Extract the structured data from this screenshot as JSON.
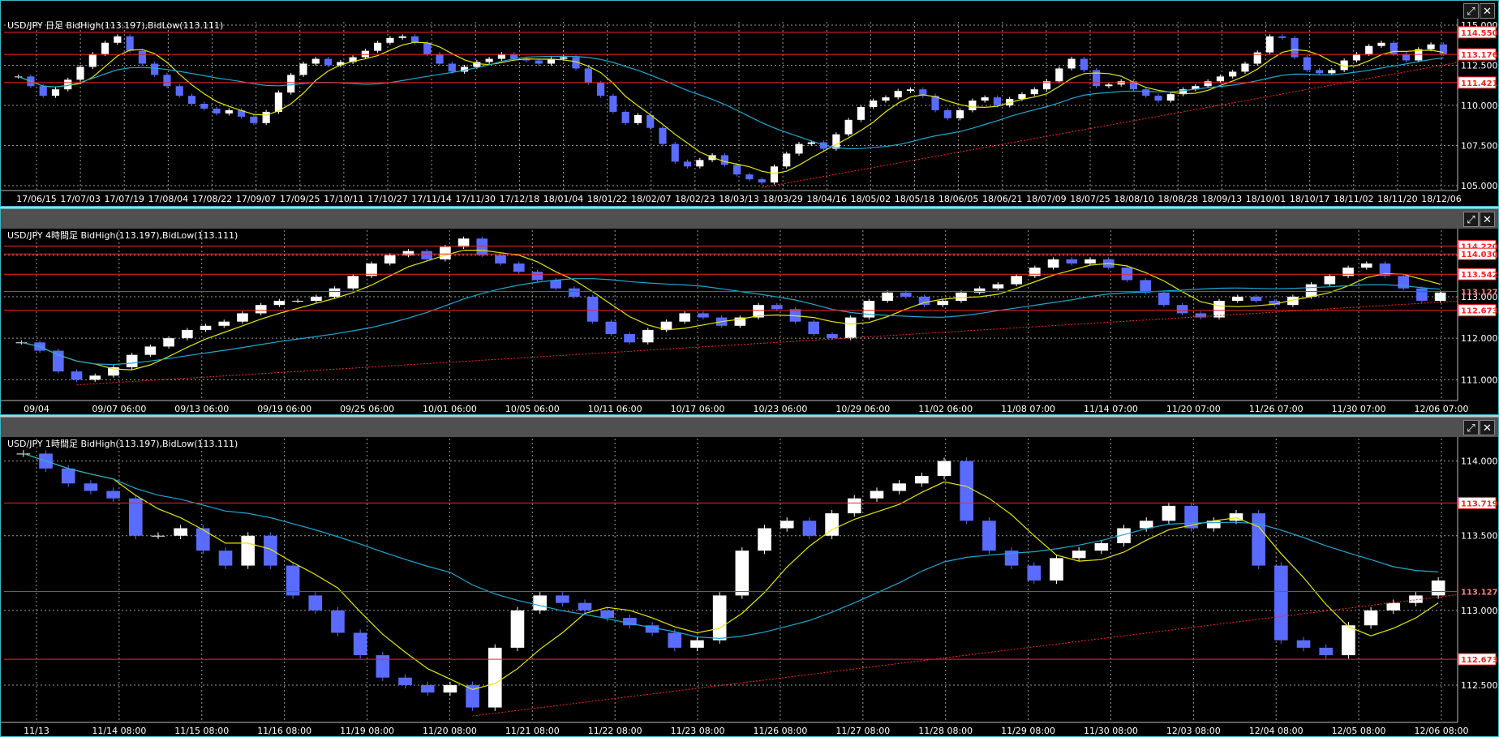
{
  "colors": {
    "frame": "#3fb8c8",
    "level_line": "#ff2020",
    "ma_fast": "#e6e600",
    "ma_slow": "#1ea8d0",
    "bull": "#ffffff",
    "bear": "#5a6cff",
    "grid": "#9a9a9a"
  },
  "window_buttons": {
    "maximize": "⤢",
    "close": "✕"
  },
  "panels": [
    {
      "title": "USD/JPY 日足  BidHigh(113.197),BidLow(113.111)",
      "y_ticks": [
        "115.000",
        "112.500",
        "110.000",
        "107.500",
        "105.000"
      ],
      "x_ticks": [
        "17/06/15",
        "17/07/03",
        "17/07/19",
        "17/08/04",
        "17/08/22",
        "17/09/07",
        "17/09/25",
        "17/10/11",
        "17/10/27",
        "17/11/14",
        "17/11/30",
        "17/12/18",
        "18/01/04",
        "18/01/22",
        "18/02/07",
        "18/02/23",
        "18/03/13",
        "18/03/29",
        "18/04/16",
        "18/05/02",
        "18/05/18",
        "18/06/05",
        "18/06/21",
        "18/07/09",
        "18/07/25",
        "18/08/10",
        "18/08/28",
        "18/09/13",
        "18/10/01",
        "18/10/17",
        "18/11/02",
        "18/11/20",
        "18/12/06"
      ],
      "level_tags": [
        {
          "text": "114.550",
          "style": "boxed"
        },
        {
          "text": "113.176",
          "style": "boxed"
        },
        {
          "text": "111.421",
          "style": "boxed"
        }
      ]
    },
    {
      "title": "USD/JPY 4時間足  BidHigh(113.197),BidLow(113.111)",
      "y_ticks": [
        "114.000",
        "113.000",
        "112.000",
        "111.000"
      ],
      "x_ticks": [
        "09/04",
        "09/07 06:00",
        "09/13 06:00",
        "09/19 06:00",
        "09/25 06:00",
        "10/01 06:00",
        "10/05 06:00",
        "10/11 06:00",
        "10/17 06:00",
        "10/23 06:00",
        "10/29 06:00",
        "11/02 06:00",
        "11/08 07:00",
        "11/14 07:00",
        "11/20 07:00",
        "11/26 07:00",
        "11/30 07:00",
        "12/06 07:00"
      ],
      "level_tags": [
        {
          "text": "114.220",
          "style": "boxed"
        },
        {
          "text": "114.030",
          "style": "boxed"
        },
        {
          "text": "113.542",
          "style": "boxed"
        },
        {
          "text": "113.127",
          "style": "plain"
        },
        {
          "text": "112.673",
          "style": "boxed"
        }
      ]
    },
    {
      "title": "USD/JPY 1時間足  BidHigh(113.197),BidLow(113.111)",
      "y_ticks": [
        "114.000",
        "113.500",
        "113.000",
        "112.500"
      ],
      "x_ticks": [
        "11/13",
        "11/14 08:00",
        "11/15 08:00",
        "11/16 08:00",
        "11/19 08:00",
        "11/20 08:00",
        "11/21 08:00",
        "11/22 08:00",
        "11/23 08:00",
        "11/26 08:00",
        "11/27 08:00",
        "11/28 08:00",
        "11/29 08:00",
        "11/30 08:00",
        "12/03 08:00",
        "12/04 08:00",
        "12/05 08:00",
        "12/06 08:00"
      ],
      "level_tags": [
        {
          "text": "113.719",
          "style": "boxed"
        },
        {
          "text": "113.127",
          "style": "plain"
        },
        {
          "text": "112.673",
          "style": "boxed"
        }
      ]
    }
  ],
  "chart_data": [
    {
      "type": "candlestick",
      "instrument": "USD/JPY",
      "timeframe": "日足",
      "ylim": [
        104.7,
        115.2
      ],
      "levels": [
        114.55,
        113.176,
        111.421
      ],
      "series": [
        {
          "name": "USD/JPY",
          "values": [
            111.8,
            111.2,
            110.6,
            111.0,
            111.6,
            112.4,
            113.2,
            113.9,
            114.3,
            113.4,
            112.6,
            111.9,
            111.2,
            110.6,
            110.1,
            109.8,
            109.5,
            109.7,
            109.3,
            108.9,
            109.6,
            110.8,
            111.9,
            112.6,
            112.9,
            112.5,
            112.7,
            113.0,
            113.4,
            113.9,
            114.2,
            114.3,
            113.9,
            113.2,
            112.6,
            112.1,
            112.4,
            112.7,
            112.9,
            113.2,
            112.9,
            112.8,
            112.6,
            112.9,
            113.0,
            112.3,
            111.4,
            110.6,
            109.6,
            108.9,
            109.4,
            108.6,
            107.6,
            106.5,
            106.2,
            106.6,
            106.9,
            106.3,
            105.7,
            105.4,
            105.2,
            106.2,
            107.0,
            107.6,
            107.7,
            107.3,
            108.2,
            109.1,
            109.9,
            110.3,
            110.5,
            110.9,
            111.0,
            110.6,
            109.7,
            109.2,
            109.7,
            110.3,
            110.5,
            110.0,
            110.4,
            110.7,
            111.0,
            111.5,
            112.3,
            112.9,
            112.2,
            111.2,
            111.3,
            111.5,
            111.0,
            110.6,
            110.3,
            110.7,
            111.0,
            111.2,
            111.5,
            111.8,
            112.1,
            112.6,
            113.3,
            114.3,
            114.2,
            113.0,
            112.2,
            112.0,
            112.2,
            112.8,
            113.2,
            113.7,
            113.9,
            113.2,
            112.8,
            113.5,
            113.8,
            113.2
          ]
        }
      ]
    },
    {
      "type": "candlestick",
      "instrument": "USD/JPY",
      "timeframe": "4時間足",
      "ylim": [
        110.5,
        114.6
      ],
      "levels": [
        114.22,
        114.03,
        113.542,
        113.127,
        112.673
      ],
      "series": [
        {
          "name": "USD/JPY",
          "values": [
            111.9,
            111.7,
            111.2,
            111.0,
            111.1,
            111.3,
            111.6,
            111.8,
            112.0,
            112.2,
            112.3,
            112.4,
            112.6,
            112.8,
            112.9,
            112.9,
            113.0,
            113.2,
            113.5,
            113.8,
            114.0,
            114.1,
            113.9,
            114.2,
            114.4,
            114.0,
            113.8,
            113.6,
            113.4,
            113.2,
            113.0,
            112.4,
            112.1,
            111.9,
            112.2,
            112.4,
            112.6,
            112.5,
            112.3,
            112.5,
            112.8,
            112.7,
            112.4,
            112.1,
            112.0,
            112.5,
            112.9,
            113.1,
            113.0,
            112.8,
            112.9,
            113.1,
            113.2,
            113.3,
            113.5,
            113.7,
            113.9,
            113.8,
            113.9,
            113.7,
            113.4,
            113.1,
            112.8,
            112.6,
            112.5,
            112.9,
            113.0,
            112.9,
            112.8,
            113.0,
            113.3,
            113.5,
            113.7,
            113.8,
            113.5,
            113.2,
            112.9,
            113.1
          ]
        }
      ]
    },
    {
      "type": "candlestick",
      "instrument": "USD/JPY",
      "timeframe": "1時間足",
      "ylim": [
        112.25,
        114.15
      ],
      "levels": [
        113.719,
        113.127,
        112.673
      ],
      "series": [
        {
          "name": "USD/JPY",
          "values": [
            114.05,
            113.95,
            113.85,
            113.8,
            113.75,
            113.5,
            113.5,
            113.55,
            113.4,
            113.3,
            113.5,
            113.3,
            113.1,
            113.0,
            112.85,
            112.7,
            112.55,
            112.5,
            112.45,
            112.5,
            112.35,
            112.75,
            113.0,
            113.1,
            113.05,
            113.0,
            112.95,
            112.9,
            112.85,
            112.75,
            112.8,
            113.1,
            113.4,
            113.55,
            113.6,
            113.5,
            113.65,
            113.75,
            113.8,
            113.85,
            113.9,
            114.0,
            113.6,
            113.4,
            113.3,
            113.2,
            113.35,
            113.4,
            113.45,
            113.55,
            113.6,
            113.7,
            113.55,
            113.6,
            113.65,
            113.3,
            112.8,
            112.75,
            112.7,
            112.9,
            113.0,
            113.05,
            113.1,
            113.2
          ]
        }
      ]
    }
  ]
}
